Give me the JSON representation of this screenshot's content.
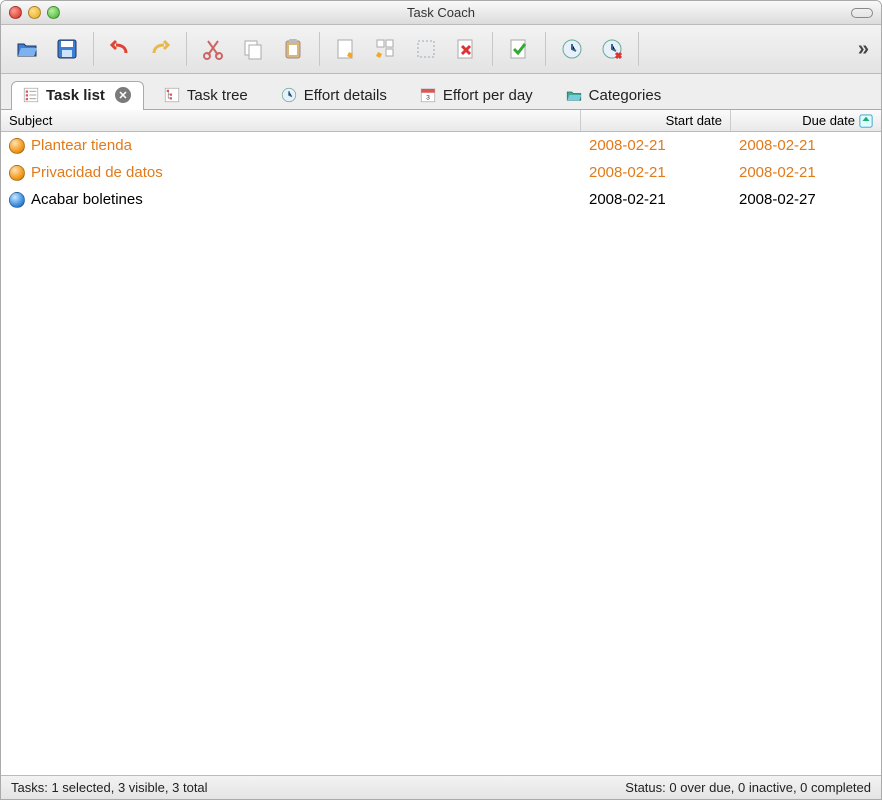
{
  "window": {
    "title": "Task Coach"
  },
  "toolbar": {
    "buttons": [
      {
        "name": "open-file-icon"
      },
      {
        "name": "save-icon"
      },
      {
        "sep": true
      },
      {
        "name": "undo-icon"
      },
      {
        "name": "redo-icon"
      },
      {
        "sep": true
      },
      {
        "name": "cut-icon"
      },
      {
        "name": "copy-icon"
      },
      {
        "name": "paste-icon"
      },
      {
        "sep": true
      },
      {
        "name": "new-task-icon"
      },
      {
        "name": "new-subtask-icon"
      },
      {
        "name": "edit-task-icon"
      },
      {
        "name": "delete-task-icon"
      },
      {
        "sep": true
      },
      {
        "name": "mark-complete-icon"
      },
      {
        "sep": true
      },
      {
        "name": "start-effort-icon"
      },
      {
        "name": "stop-effort-icon"
      },
      {
        "sep": true
      }
    ]
  },
  "tabs": [
    {
      "label": "Task list",
      "icon": "task-list-icon",
      "active": true,
      "closable": true
    },
    {
      "label": "Task tree",
      "icon": "task-tree-icon",
      "active": false
    },
    {
      "label": "Effort details",
      "icon": "clock-icon",
      "active": false
    },
    {
      "label": "Effort per day",
      "icon": "calendar-icon",
      "active": false
    },
    {
      "label": "Categories",
      "icon": "categories-icon",
      "active": false
    }
  ],
  "columns": {
    "subject": "Subject",
    "start_date": "Start date",
    "due_date": "Due date"
  },
  "tasks": [
    {
      "subject": "Plantear tienda",
      "start_date": "2008-02-21",
      "due_date": "2008-02-21",
      "status": "overdue",
      "ball": "orange"
    },
    {
      "subject": "Privacidad de datos",
      "start_date": "2008-02-21",
      "due_date": "2008-02-21",
      "status": "overdue",
      "ball": "orange"
    },
    {
      "subject": "Acabar boletines",
      "start_date": "2008-02-21",
      "due_date": "2008-02-27",
      "status": "normal",
      "ball": "blue"
    }
  ],
  "status": {
    "left": "Tasks: 1 selected, 3 visible, 3 total",
    "right": "Status: 0 over due, 0 inactive, 0 completed"
  },
  "colors": {
    "overdue": "#e07a1a"
  }
}
